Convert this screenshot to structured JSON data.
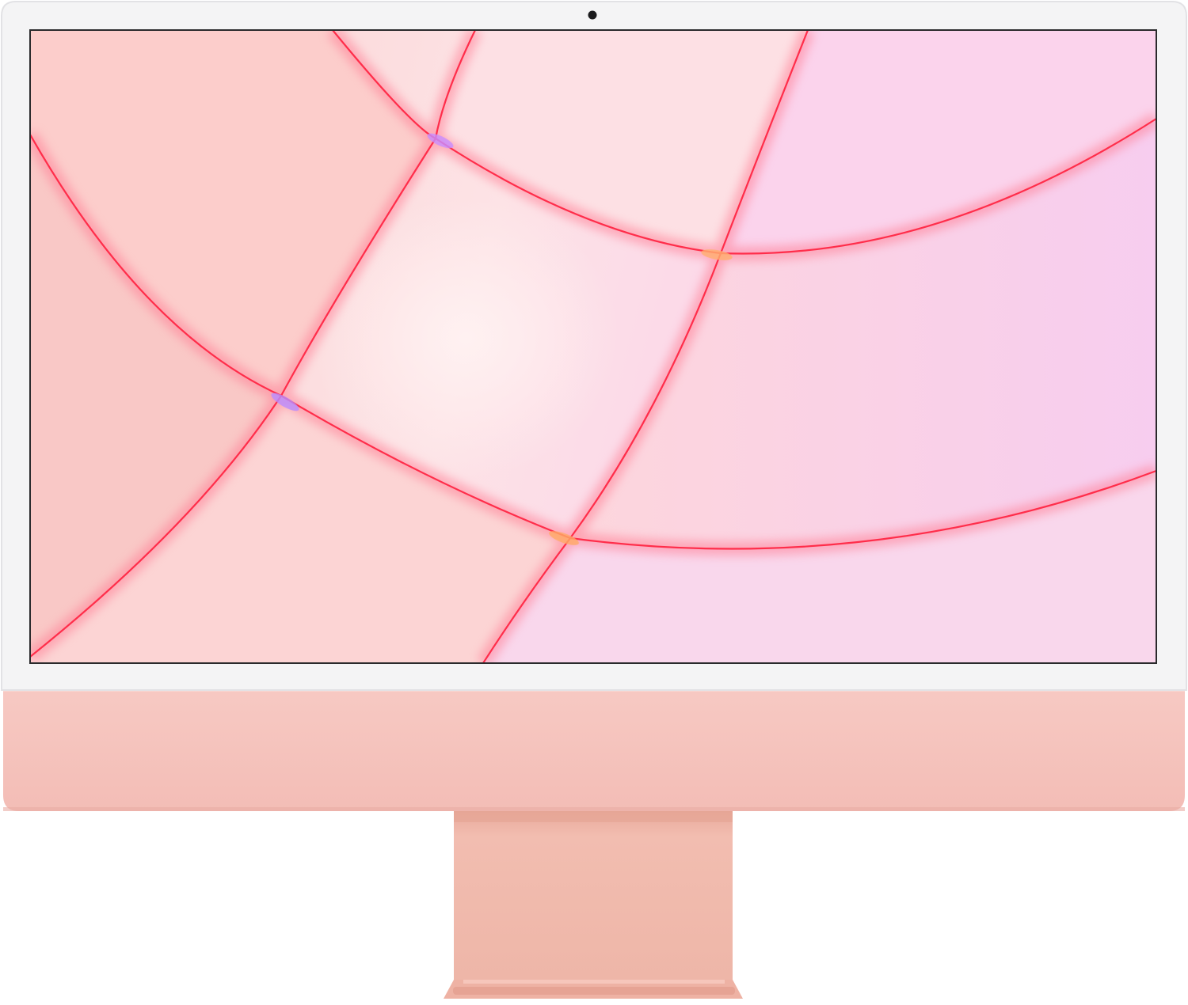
{
  "colors": {
    "bezel": "#f3f3f3",
    "bezel_edge": "#e4e4e6",
    "chin": "#f6c6c0",
    "chin_shade": "#f1b8b1",
    "stand": "#f0b9ac",
    "stand_shade": "#e7a898",
    "stand_foot": "#e9a99a",
    "camera": "#1b1b1d",
    "wall_light": "#fde8ea",
    "wall_mid": "#f9cfd2",
    "wall_lavender": "#ecd6f5",
    "seam_red": "#ff2d4a",
    "seam_glow": "#ff8fa3"
  },
  "icons": {
    "camera": "camera-dot-icon"
  }
}
